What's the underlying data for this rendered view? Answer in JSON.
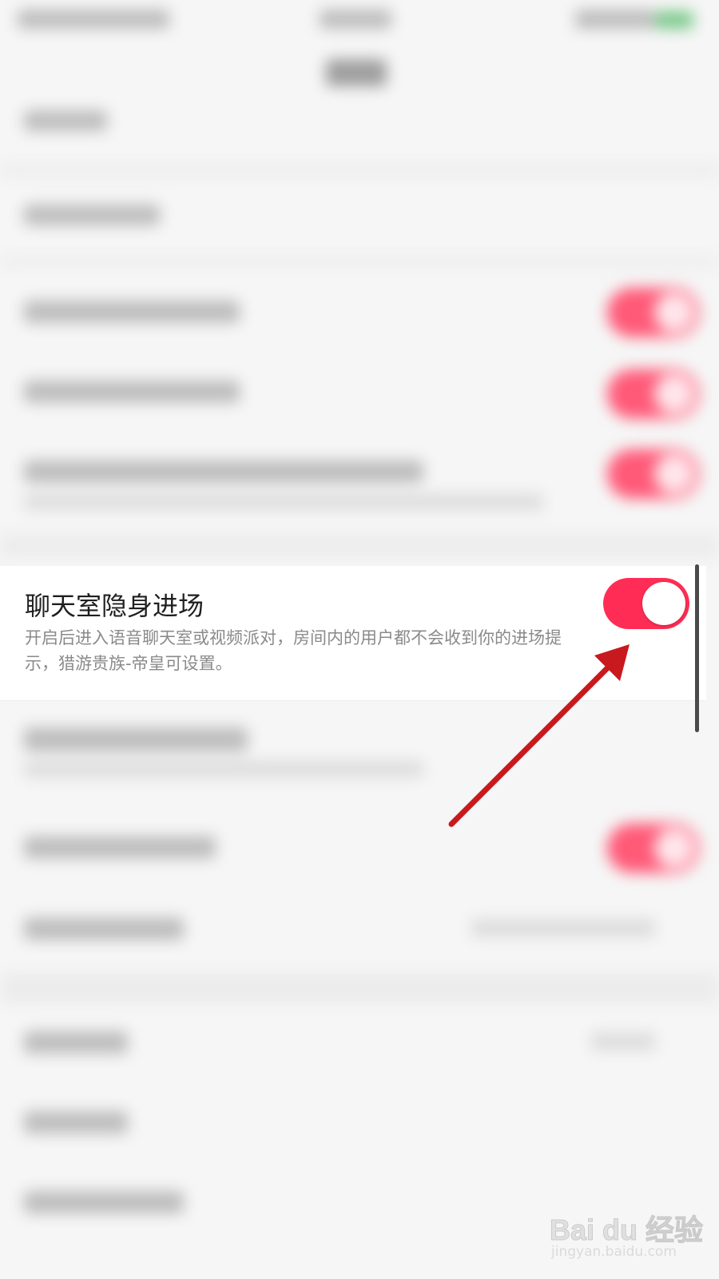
{
  "setting_row": {
    "title": "聊天室隐身进场",
    "description": "开启后进入语音聊天室或视频派对，房间内的用户都不会收到你的进场提示，猎游贵族-帝皇可设置。",
    "toggle_state": "on",
    "toggle_color": "#ff2d55"
  },
  "annotation": {
    "arrow_color": "#c8191e"
  },
  "watermark": {
    "logo": "Bai du 经验",
    "url": "jingyan.baidu.com"
  }
}
